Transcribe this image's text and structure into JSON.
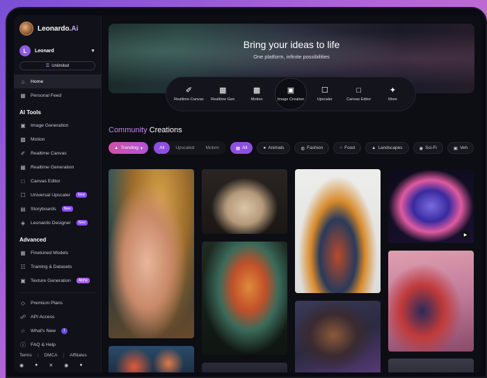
{
  "brand": {
    "name": "Leonardo.",
    "suffix": "Ai"
  },
  "user": {
    "initial": "L",
    "name": "Leonard",
    "plan": "Unlimited"
  },
  "nav": {
    "home": "Home",
    "personal_feed": "Personal Feed",
    "ai_tools_title": "AI Tools",
    "ai_tools": [
      {
        "label": "Image Generation",
        "icon": "image-icon"
      },
      {
        "label": "Motion",
        "icon": "film-icon"
      },
      {
        "label": "Realtime Canvas",
        "icon": "brush-icon"
      },
      {
        "label": "Realtime Generation",
        "icon": "grid-icon"
      },
      {
        "label": "Canvas Editor",
        "icon": "canvas-icon"
      },
      {
        "label": "Universal Upscaler",
        "icon": "upscale-icon",
        "badge": "New"
      },
      {
        "label": "Storyboards",
        "icon": "storyboard-icon",
        "badge": "New"
      },
      {
        "label": "Leonardo Designer",
        "icon": "designer-icon",
        "badge": "New"
      }
    ],
    "advanced_title": "Advanced",
    "advanced": [
      {
        "label": "Finetuned Models",
        "icon": "model-icon"
      },
      {
        "label": "Training & Datasets",
        "icon": "dataset-icon"
      },
      {
        "label": "Texture Generation",
        "icon": "texture-icon",
        "badge": "Alpha"
      }
    ],
    "extras": [
      {
        "label": "Premium Plans",
        "icon": "diamond-icon"
      },
      {
        "label": "API Access",
        "icon": "api-icon"
      },
      {
        "label": "What's New",
        "icon": "bell-icon",
        "count": "1"
      },
      {
        "label": "FAQ & Help",
        "icon": "help-icon"
      }
    ]
  },
  "footer": {
    "terms": "Terms",
    "dmca": "DMCA",
    "affiliates": "Affiliates"
  },
  "hero": {
    "title": "Bring your ideas to life",
    "subtitle": "One platform, infinite possibilities"
  },
  "tools": [
    {
      "label": "Realtime Canvas",
      "icon": "brush-icon"
    },
    {
      "label": "Realtime Gen",
      "icon": "grid-icon"
    },
    {
      "label": "Motion",
      "icon": "film-icon"
    },
    {
      "label": "Image Creation",
      "icon": "image-icon"
    },
    {
      "label": "Upscaler",
      "icon": "upscale-icon"
    },
    {
      "label": "Canvas Editor",
      "icon": "canvas-icon"
    },
    {
      "label": "More",
      "icon": "sparkle-icon"
    }
  ],
  "community": {
    "highlight": "Community",
    "rest": " Creations"
  },
  "filters": {
    "trending": "Trending",
    "type_tabs": [
      "All",
      "Upscaled",
      "Motion"
    ],
    "categories": [
      "All",
      "Animals",
      "Fashion",
      "Food",
      "Landscapes",
      "Sci-Fi",
      "Veh"
    ]
  }
}
